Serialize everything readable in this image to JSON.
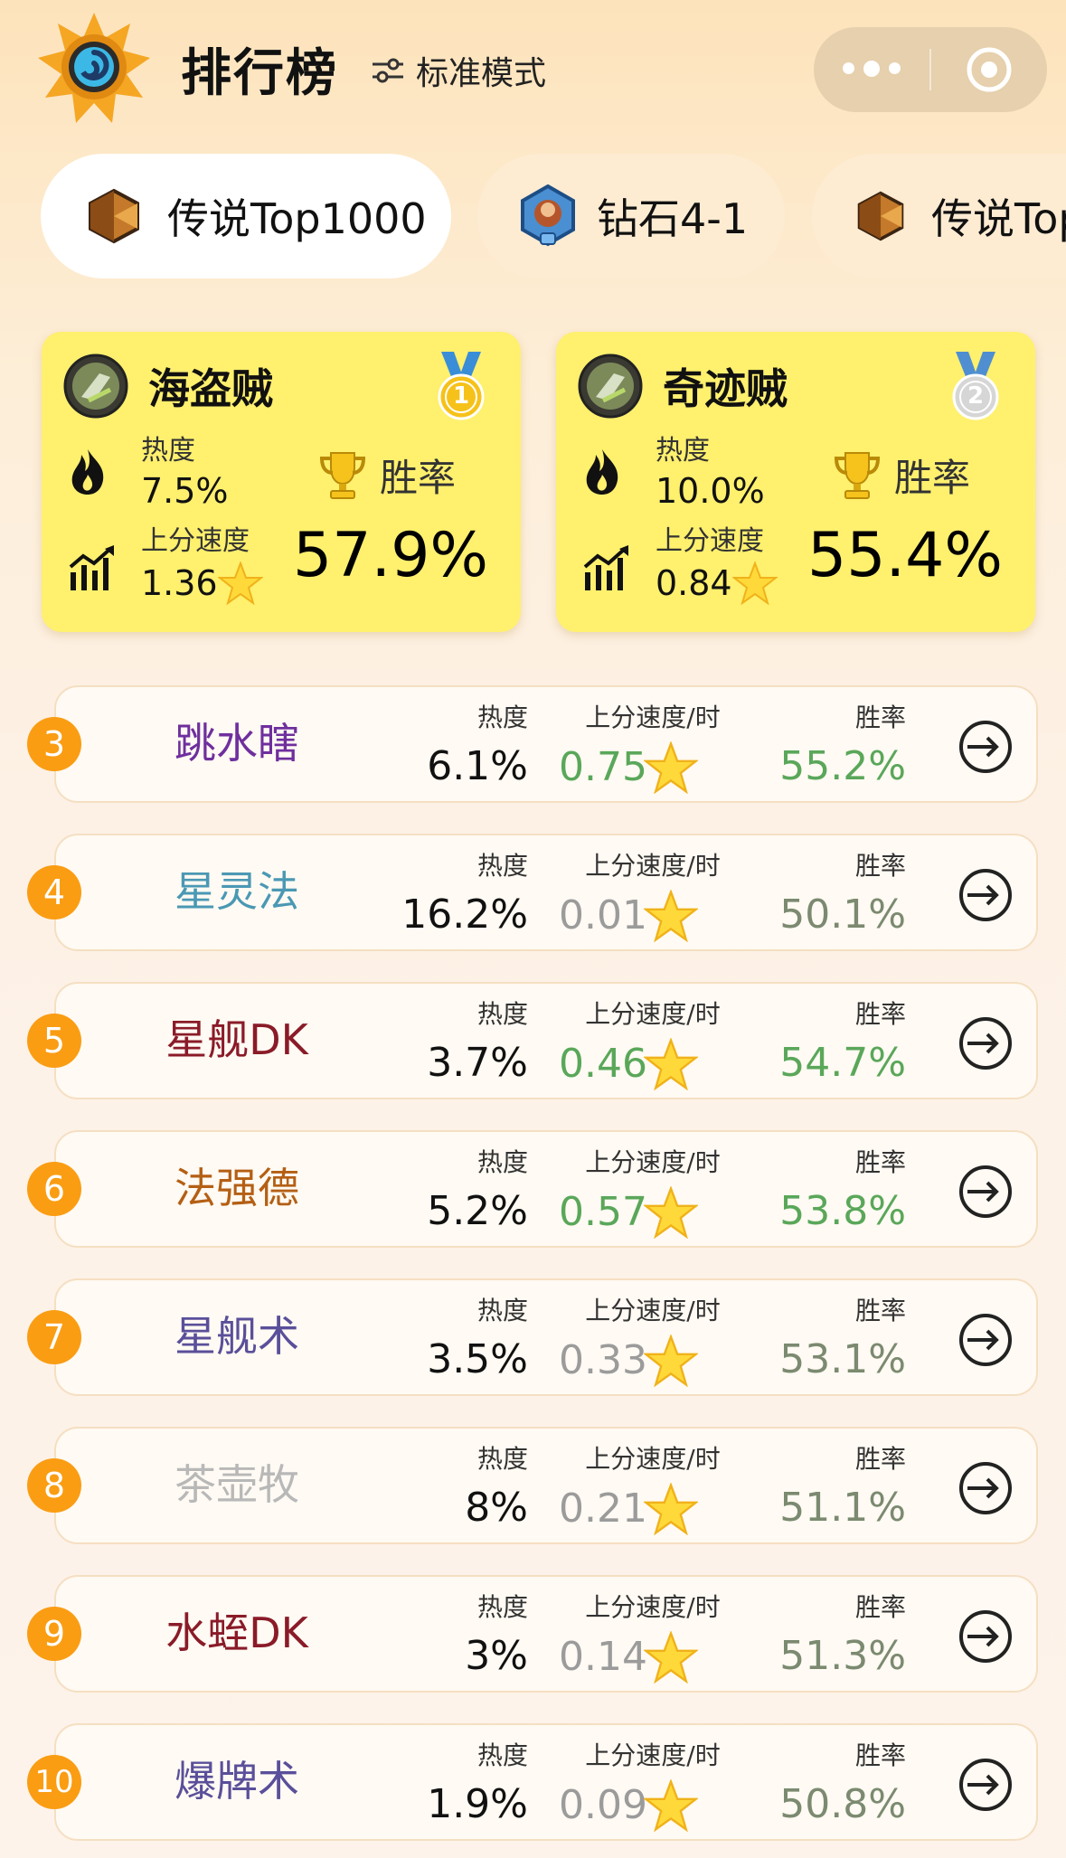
{
  "header": {
    "title": "排行榜",
    "mode_label": "标准模式"
  },
  "tabs": [
    {
      "label": "传说Top1000",
      "icon": "legend-rank-icon",
      "active": true
    },
    {
      "label": "钻石4-1",
      "icon": "diamond-rank-icon",
      "active": false
    },
    {
      "label": "传说Top",
      "icon": "legend-rank-icon",
      "active": false
    }
  ],
  "top_cards": [
    {
      "rank": 1,
      "name": "海盗贼",
      "medal": "gold-medal-icon",
      "medal_number": "1",
      "heat_label": "热度",
      "heat": "7.5%",
      "speed_label": "上分速度",
      "speed": "1.36",
      "win_label": "胜率",
      "winrate": "57.9%"
    },
    {
      "rank": 2,
      "name": "奇迹贼",
      "medal": "silver-medal-icon",
      "medal_number": "2",
      "heat_label": "热度",
      "heat": "10.0%",
      "speed_label": "上分速度",
      "speed": "0.84",
      "win_label": "胜率",
      "winrate": "55.4%"
    }
  ],
  "column_labels": {
    "heat": "热度",
    "speed": "上分速度/时",
    "winrate": "胜率"
  },
  "rows": [
    {
      "rank": "3",
      "name": "跳水瞎",
      "heat": "6.1%",
      "speed": "0.75",
      "winrate": "55.2%",
      "name_color": "#6f2f9e",
      "good": true
    },
    {
      "rank": "4",
      "name": "星灵法",
      "heat": "16.2%",
      "speed": "0.01",
      "winrate": "50.1%",
      "name_color": "#4a98b4",
      "good": false
    },
    {
      "rank": "5",
      "name": "星舰DK",
      "heat": "3.7%",
      "speed": "0.46",
      "winrate": "54.7%",
      "name_color": "#8a1b28",
      "good": true
    },
    {
      "rank": "6",
      "name": "法强德",
      "heat": "5.2%",
      "speed": "0.57",
      "winrate": "53.8%",
      "name_color": "#b45f14",
      "good": true
    },
    {
      "rank": "7",
      "name": "星舰术",
      "heat": "3.5%",
      "speed": "0.33",
      "winrate": "53.1%",
      "name_color": "#5a4f9a",
      "good": false
    },
    {
      "rank": "8",
      "name": "茶壶牧",
      "heat": "8%",
      "speed": "0.21",
      "winrate": "51.1%",
      "name_color": "#b8b8b8",
      "good": false
    },
    {
      "rank": "9",
      "name": "水蛭DK",
      "heat": "3%",
      "speed": "0.14",
      "winrate": "51.3%",
      "name_color": "#8a1b28",
      "good": false
    },
    {
      "rank": "10",
      "name": "爆牌术",
      "heat": "1.9%",
      "speed": "0.09",
      "winrate": "50.8%",
      "name_color": "#5a4f9a",
      "good": false
    }
  ],
  "colors": {
    "rank_badge": "#fa9d13",
    "good_green": "#5aa75a",
    "neutral_gray": "#7b8a70",
    "speed_low_gray": "#9b9b9b",
    "card_yellow": "#fff06e"
  }
}
